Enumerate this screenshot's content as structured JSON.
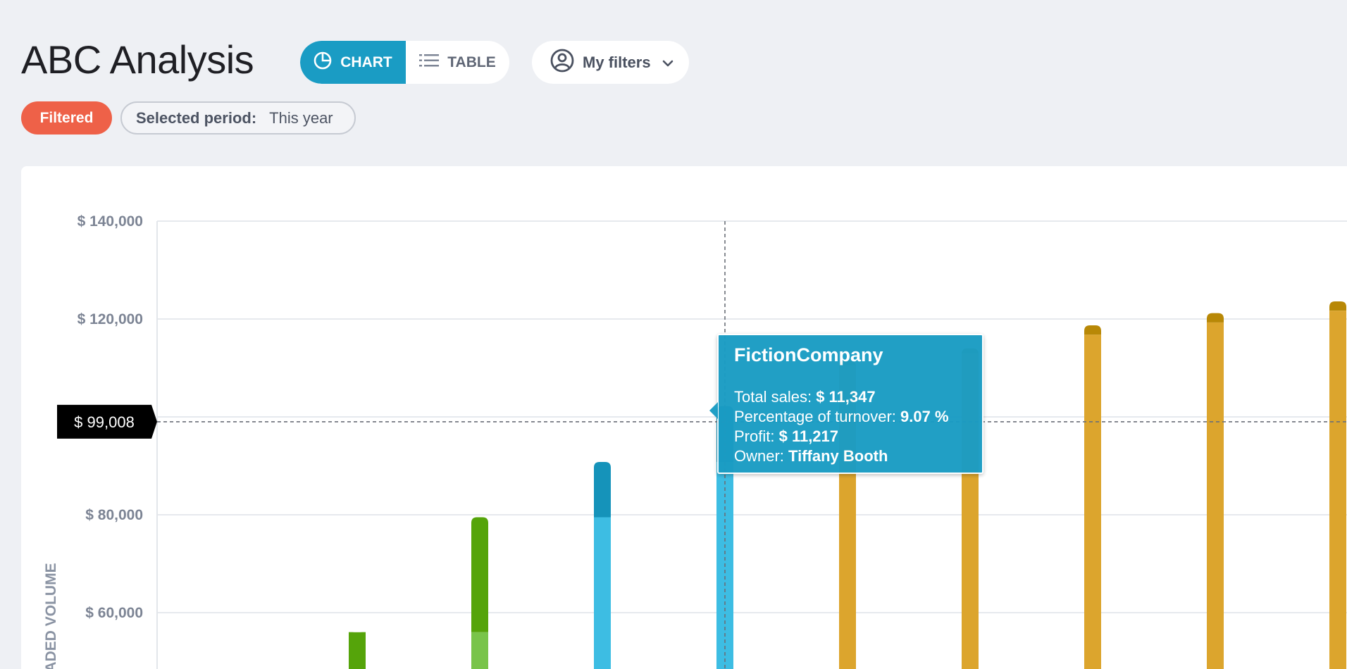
{
  "page": {
    "title": "ABC Analysis"
  },
  "view_toggle": {
    "chart_label": "CHART",
    "table_label": "TABLE",
    "active": "chart"
  },
  "filters_button": {
    "label": "My filters"
  },
  "filter_status": {
    "badge": "Filtered",
    "period_label": "Selected period:",
    "period_value": "This year"
  },
  "tooltip": {
    "title": "FictionCompany",
    "total_sales_label": "Total sales:",
    "total_sales_value": "$ 11,347",
    "turnover_label": "Percentage of turnover:",
    "turnover_value": "9.07 %",
    "profit_label": "Profit:",
    "profit_value": "$ 11,217",
    "owner_label": "Owner:",
    "owner_value": "Tiffany Booth"
  },
  "crosshair": {
    "value_label": "$ 99,008",
    "y_value": 99008
  },
  "colors": {
    "accent": "#1a9cc4",
    "filtered_badge": "#ee6148",
    "class_a_top": "#55a40a",
    "class_a_bottom": "#79c44a",
    "class_b_top": "#1593ba",
    "class_b_bottom": "#3dbde3",
    "class_c_top": "#b88806",
    "class_c_bottom": "#dca52d"
  },
  "chart_data": {
    "type": "bar",
    "ylabel": "TRADED VOLUME",
    "yticks": [
      "$ 140,000",
      "$ 120,000",
      "$ 80,000",
      "$ 60,000"
    ],
    "ytick_values": [
      140000,
      120000,
      80000,
      60000
    ],
    "ylim_visible": [
      40000,
      140000
    ],
    "bars": [
      {
        "index": 1,
        "class": "A",
        "base_top": 56000,
        "total": 56000
      },
      {
        "index": 2,
        "class": "A",
        "base_top": 56000,
        "total": 79500
      },
      {
        "index": 3,
        "class": "B",
        "base_top": 79500,
        "total": 90800
      },
      {
        "index": 4,
        "class": "B",
        "base_top": 90800,
        "total": 102200,
        "highlighted": true
      },
      {
        "index": 5,
        "class": "C",
        "base_top": 110500,
        "total": 111500
      },
      {
        "index": 6,
        "class": "C",
        "base_top": 113000,
        "total": 114000
      },
      {
        "index": 7,
        "class": "C",
        "base_top": 116800,
        "total": 118700
      },
      {
        "index": 8,
        "class": "C",
        "base_top": 119300,
        "total": 121200
      },
      {
        "index": 9,
        "class": "C",
        "base_top": 121700,
        "total": 123600
      }
    ]
  }
}
